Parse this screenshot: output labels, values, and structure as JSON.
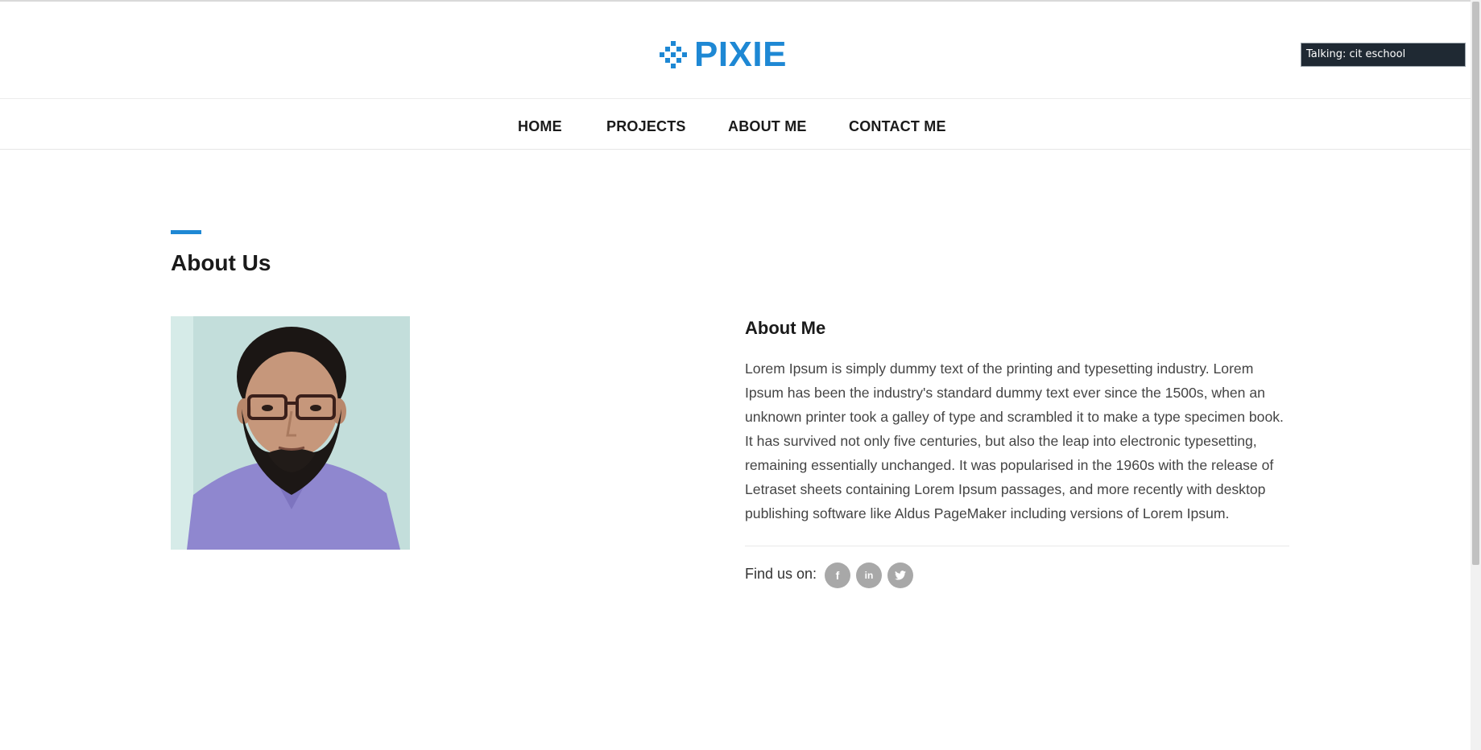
{
  "header": {
    "logo_text": "PIXIE",
    "brand_color": "#1e88d4",
    "logo_icon": "pixel-diamond-icon"
  },
  "overlay": {
    "talking_label": "Talking: cit eschool"
  },
  "nav": {
    "items": [
      {
        "label": "HOME"
      },
      {
        "label": "PROJECTS"
      },
      {
        "label": "ABOUT ME"
      },
      {
        "label": "CONTACT ME"
      }
    ]
  },
  "main": {
    "section_title": "About Us",
    "about_title": "About Me",
    "about_text": "Lorem Ipsum is simply dummy text of the printing and typesetting industry. Lorem Ipsum has been the industry's standard dummy text ever since the 1500s, when an unknown printer took a galley of type and scrambled it to make a type specimen book. It has survived not only five centuries, but also the leap into electronic typesetting, remaining essentially unchanged. It was popularised in the 1960s with the release of Letraset sheets containing Lorem Ipsum passages, and more recently with desktop publishing software like Aldus PageMaker including versions of Lorem Ipsum.",
    "find_us_label": "Find us on:",
    "social_icons": [
      "facebook-icon",
      "linkedin-icon",
      "twitter-icon"
    ],
    "social": {
      "facebook": "f",
      "linkedin": "in"
    }
  }
}
